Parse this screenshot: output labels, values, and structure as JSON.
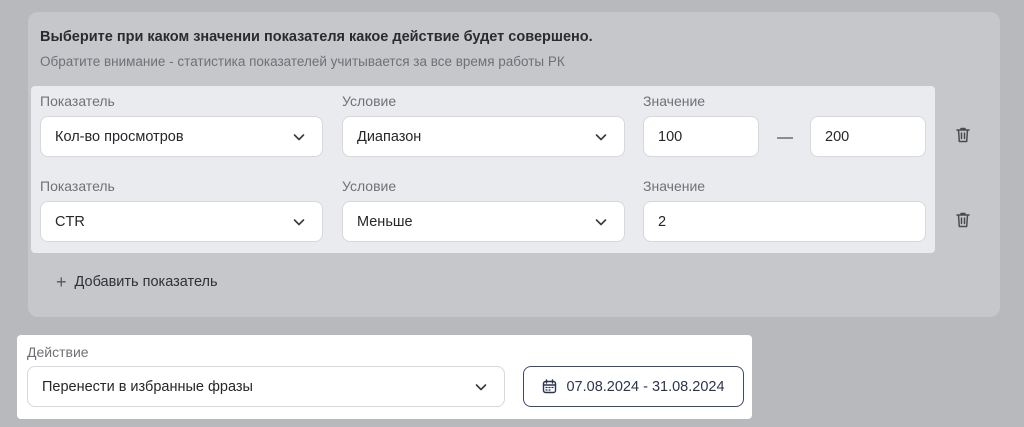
{
  "hint": {
    "title": "Выберите при каком значении показателя какое действие будет совершено.",
    "subtitle": "Обратите внимание - статистика показателей учитывается за все время работы РК"
  },
  "rules": [
    {
      "metric_label": "Показатель",
      "metric_value": "Кол-во просмотров",
      "condition_label": "Условие",
      "condition_value": "Диапазон",
      "value_label": "Значение",
      "value_from": "100",
      "value_to": "200"
    },
    {
      "metric_label": "Показатель",
      "metric_value": "CTR",
      "condition_label": "Условие",
      "condition_value": "Меньше",
      "value_label": "Значение",
      "value": "2"
    }
  ],
  "add_metric_label": "Добавить показатель",
  "action": {
    "label": "Действие",
    "value": "Перенести в избранные фразы",
    "date_range": "07.08.2024 - 31.08.2024"
  },
  "colors": {
    "background": "#b8b9bd",
    "panel": "#c6c7cb",
    "rules_area": "#eaebee",
    "field": "#ffffff",
    "accent_border": "#3f4a6b"
  }
}
